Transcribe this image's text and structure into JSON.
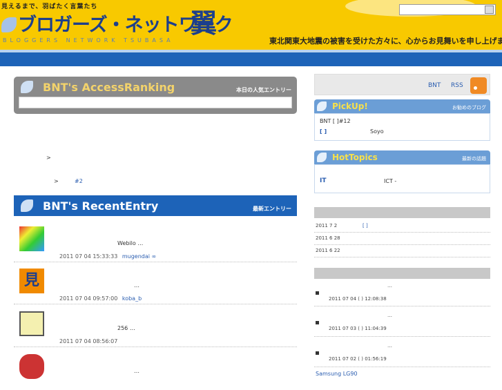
{
  "header": {
    "tagline": "見えるまで、羽ばたく言葉たち",
    "logo": "ブロガーズ・ネットワーク",
    "logo_kanji": "翼",
    "logo_sub": "BLOGGERS NETWORK TSUBASA",
    "condolence": "東北関東大地震の被害を受けた方々に、心からお見舞いを申し上げます。",
    "search_placeholder": ""
  },
  "ranking": {
    "title": "BNT's AccessRanking",
    "subtitle": "本日の人気エントリー"
  },
  "crumbs": [
    {
      "text": ">"
    },
    {
      "text": ">",
      "link": "#2"
    }
  ],
  "recent": {
    "title": "BNT's RecentEntry",
    "subtitle": "最新エントリー",
    "entries": [
      {
        "text": "Webilo …",
        "date": "2011 07 04",
        "time": "15:33:33",
        "author": "mugendai ∞"
      },
      {
        "text": "…",
        "date": "2011 07 04",
        "time": "09:57:00",
        "author": "koba_b"
      },
      {
        "text": "256 …",
        "date": "2011 07 04",
        "time": "08:56:07",
        "author": ""
      },
      {
        "text": "…",
        "date": "",
        "time": "",
        "author": ""
      }
    ]
  },
  "rss": {
    "label1": "BNT",
    "label2": "RSS"
  },
  "pickup": {
    "title": "PickUp!",
    "subtitle": "お勧めのブログ",
    "line1": "BNT [ ]#12",
    "line2_link": "[ ]",
    "line2_author": "Soyo"
  },
  "hottopics": {
    "title": "HotTopics",
    "subtitle": "最新の話題",
    "link": "IT",
    "text": "ICT -"
  },
  "news": [
    {
      "date": "2011 7 2",
      "link": "[ ]"
    },
    {
      "date": "2011 6 28",
      "link": ""
    },
    {
      "date": "2011 6 22",
      "link": ""
    }
  ],
  "qa": [
    {
      "text": "…",
      "date": "2011 07 04 ( ) 12:08:38"
    },
    {
      "text": "…",
      "date": "2011 07 03 ( ) 11:04:39"
    },
    {
      "text": "…",
      "date": "2011 07 02 ( ) 01:56:19"
    }
  ],
  "bottom_link": "Samsung LG90"
}
